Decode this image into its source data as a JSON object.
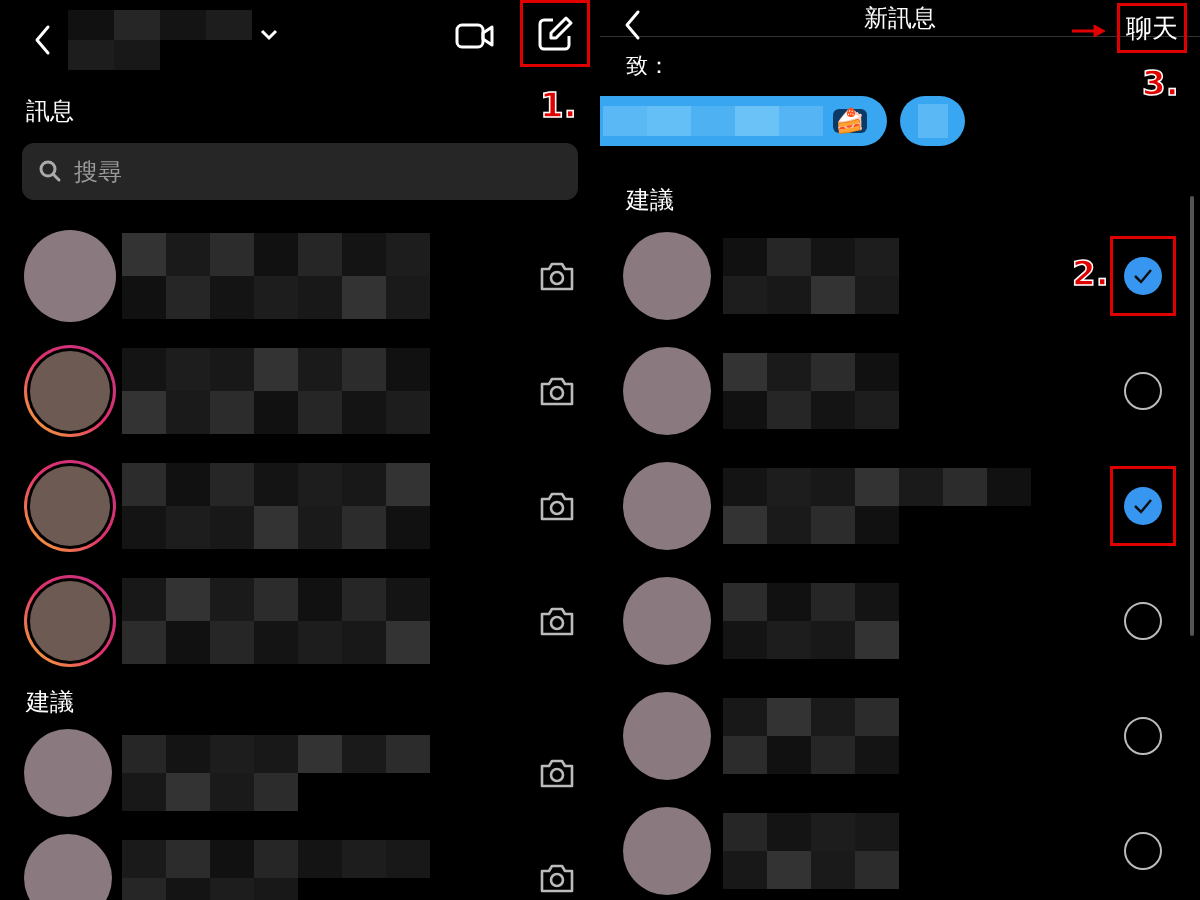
{
  "inbox": {
    "section_title": "訊息",
    "search": {
      "placeholder": "搜尋"
    },
    "conversations": [
      {
        "story_ring": false
      },
      {
        "story_ring": true
      },
      {
        "story_ring": true
      },
      {
        "story_ring": true
      }
    ],
    "suggested_title": "建議",
    "suggested": [
      {
        "story_ring": false
      },
      {
        "story_ring": false
      }
    ]
  },
  "new_message": {
    "title": "新訊息",
    "chat_button": "聊天",
    "to_label": "致：",
    "recipients": [
      {
        "kind": "named",
        "emoji": "🍰"
      },
      {
        "kind": "short"
      }
    ],
    "suggested_title": "建議",
    "suggestions": [
      {
        "selected": true
      },
      {
        "selected": false
      },
      {
        "selected": true
      },
      {
        "selected": false
      },
      {
        "selected": false
      },
      {
        "selected": false
      }
    ]
  },
  "annotations": [
    {
      "label": "1."
    },
    {
      "label": "2."
    },
    {
      "label": "3."
    }
  ]
}
